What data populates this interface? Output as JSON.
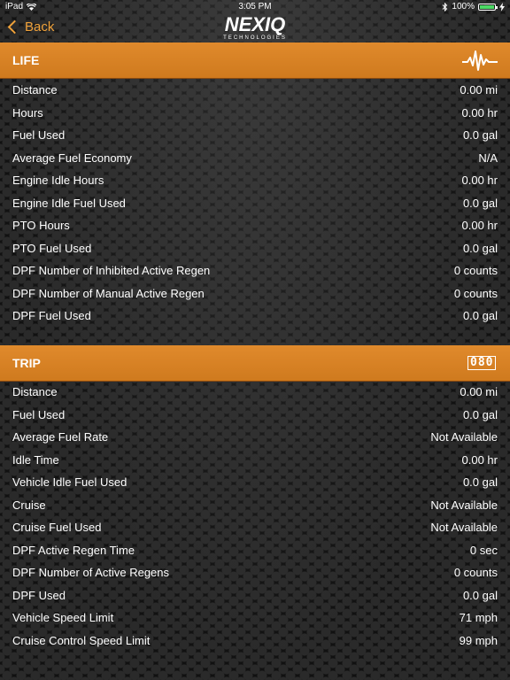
{
  "status_bar": {
    "device": "iPad",
    "time": "3:05 PM",
    "battery": "100%",
    "battery_level": 1.0
  },
  "nav": {
    "back_label": "Back",
    "logo_main": "NEXIQ",
    "logo_sub": "TECHNOLOGIES",
    "accent_color": "#f0a23a"
  },
  "life": {
    "title": "LIFE",
    "icon": "waveform-icon",
    "rows": [
      {
        "label": "Distance",
        "value": "0.00 mi"
      },
      {
        "label": "Hours",
        "value": "0.00 hr"
      },
      {
        "label": "Fuel Used",
        "value": "0.0 gal"
      },
      {
        "label": "Average Fuel Economy",
        "value": "N/A"
      },
      {
        "label": "Engine Idle Hours",
        "value": "0.00 hr"
      },
      {
        "label": "Engine Idle Fuel Used",
        "value": "0.0 gal"
      },
      {
        "label": "PTO Hours",
        "value": "0.00 hr"
      },
      {
        "label": "PTO Fuel Used",
        "value": "0.0 gal"
      },
      {
        "label": "DPF Number of Inhibited Active Regen",
        "value": "0 counts"
      },
      {
        "label": "DPF Number of Manual Active Regen",
        "value": "0 counts"
      },
      {
        "label": "DPF Fuel Used",
        "value": "0.0 gal"
      }
    ]
  },
  "trip": {
    "title": "TRIP",
    "icon": "odometer-icon",
    "icon_text": "080",
    "rows": [
      {
        "label": "Distance",
        "value": "0.00 mi"
      },
      {
        "label": "Fuel Used",
        "value": "0.0 gal"
      },
      {
        "label": "Average Fuel Rate",
        "value": "Not Available"
      },
      {
        "label": "Idle Time",
        "value": "0.00 hr"
      },
      {
        "label": "Vehicle Idle Fuel Used",
        "value": "0.0 gal"
      },
      {
        "label": "Cruise",
        "value": "Not Available"
      },
      {
        "label": "Cruise Fuel Used",
        "value": "Not Available"
      },
      {
        "label": "DPF Active Regen Time",
        "value": "0 sec"
      },
      {
        "label": "DPF Number of Active Regens",
        "value": "0 counts"
      },
      {
        "label": "DPF Used",
        "value": "0.0 gal"
      },
      {
        "label": "Vehicle Speed Limit",
        "value": "71 mph"
      },
      {
        "label": "Cruise Control Speed Limit",
        "value": "99 mph"
      }
    ]
  }
}
